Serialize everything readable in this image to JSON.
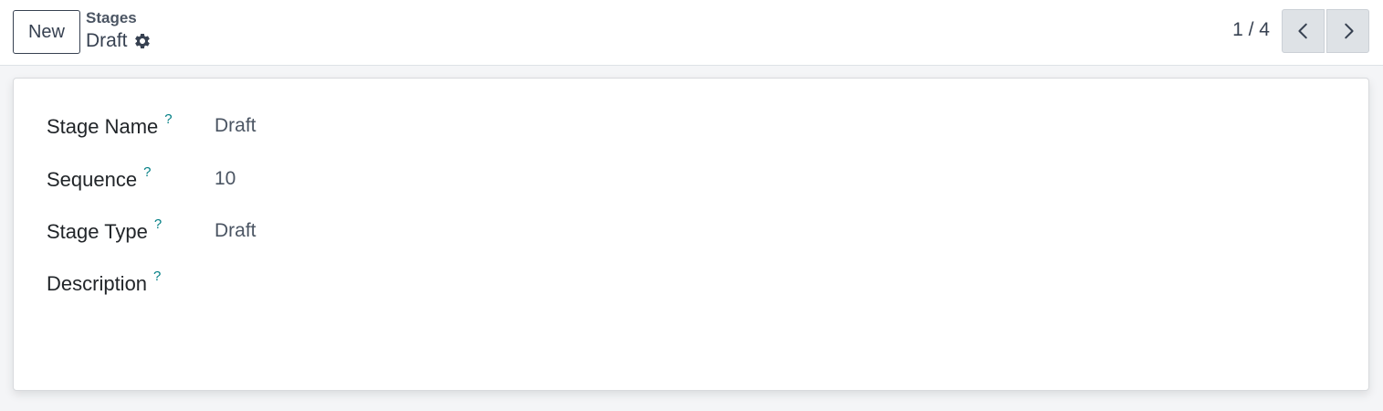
{
  "control_panel": {
    "new_button_label": "New",
    "breadcrumb": {
      "parent": "Stages",
      "current": "Draft"
    },
    "pager": {
      "value": "1 / 4"
    }
  },
  "form": {
    "fields": [
      {
        "label": "Stage Name",
        "help": "?",
        "value": "Draft"
      },
      {
        "label": "Sequence",
        "help": "?",
        "value": "10"
      },
      {
        "label": "Stage Type",
        "help": "?",
        "value": "Draft"
      },
      {
        "label": "Description",
        "help": "?",
        "value": ""
      }
    ]
  },
  "colors": {
    "help_accent": "#017e84",
    "pager_button_bg": "#dee2e6"
  },
  "icons": [
    "gear-icon",
    "chevron-left-icon",
    "chevron-right-icon"
  ]
}
